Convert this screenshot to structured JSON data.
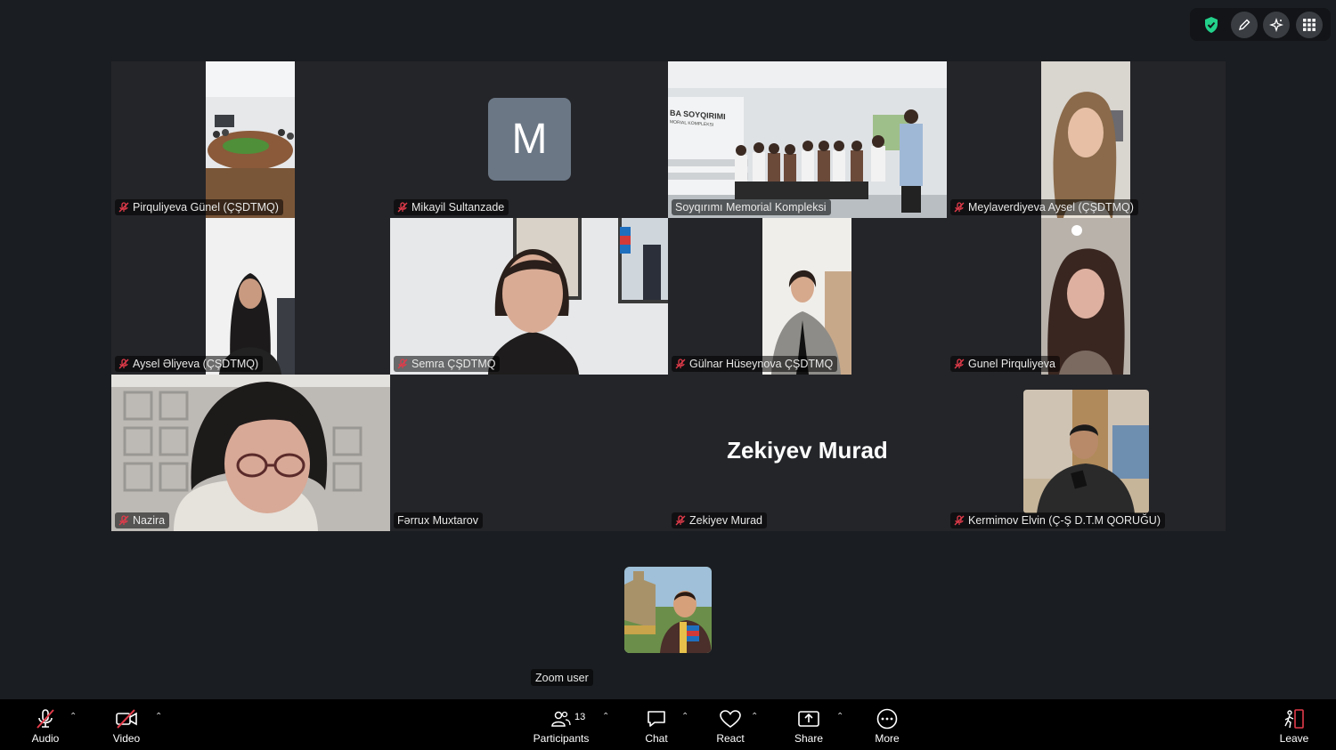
{
  "participants": [
    {
      "name": "Pirquliyeva Günel (ÇŞDTMQ)",
      "muted": true
    },
    {
      "name": "Mikayil Sultanzade",
      "muted": true,
      "avatar_letter": "M"
    },
    {
      "name": "Soyqırımı Memorial Kompleksi",
      "muted": false,
      "speaking": true
    },
    {
      "name": "Meylaverdiyeva Aysel (ÇŞDTMQ)",
      "muted": true
    },
    {
      "name": "Aysel Əliyeva (ÇŞDTMQ)",
      "muted": true
    },
    {
      "name": "Semra ÇŞDTMQ",
      "muted": true
    },
    {
      "name": "Gülnar Hüseynova ÇŞDTMQ",
      "muted": true
    },
    {
      "name": "Gunel Pirquliyeva",
      "muted": true
    },
    {
      "name": "Nazira",
      "muted": true
    },
    {
      "name": "Fərrux Muxtarov",
      "muted": false
    },
    {
      "name": "Zekiyev Murad",
      "muted": true,
      "display_name": "Zekiyev Murad"
    },
    {
      "name": "Kermimov Elvin (Ç-Ş D.T.M QORUĞU)",
      "muted": true
    }
  ],
  "room_sign": "BA SOYQIRIMI",
  "room_sign_sub": "MORIAL KOMPLEKSI",
  "self_view": {
    "name": "Zoom user"
  },
  "toolbar": {
    "audio": "Audio",
    "video": "Video",
    "participants": "Participants",
    "participants_count": "13",
    "chat": "Chat",
    "react": "React",
    "share": "Share",
    "more": "More",
    "leave": "Leave"
  },
  "colors": {
    "active_speaker": "#23d18b",
    "muted_icon": "#e23b4a",
    "shield": "#23d18b"
  }
}
